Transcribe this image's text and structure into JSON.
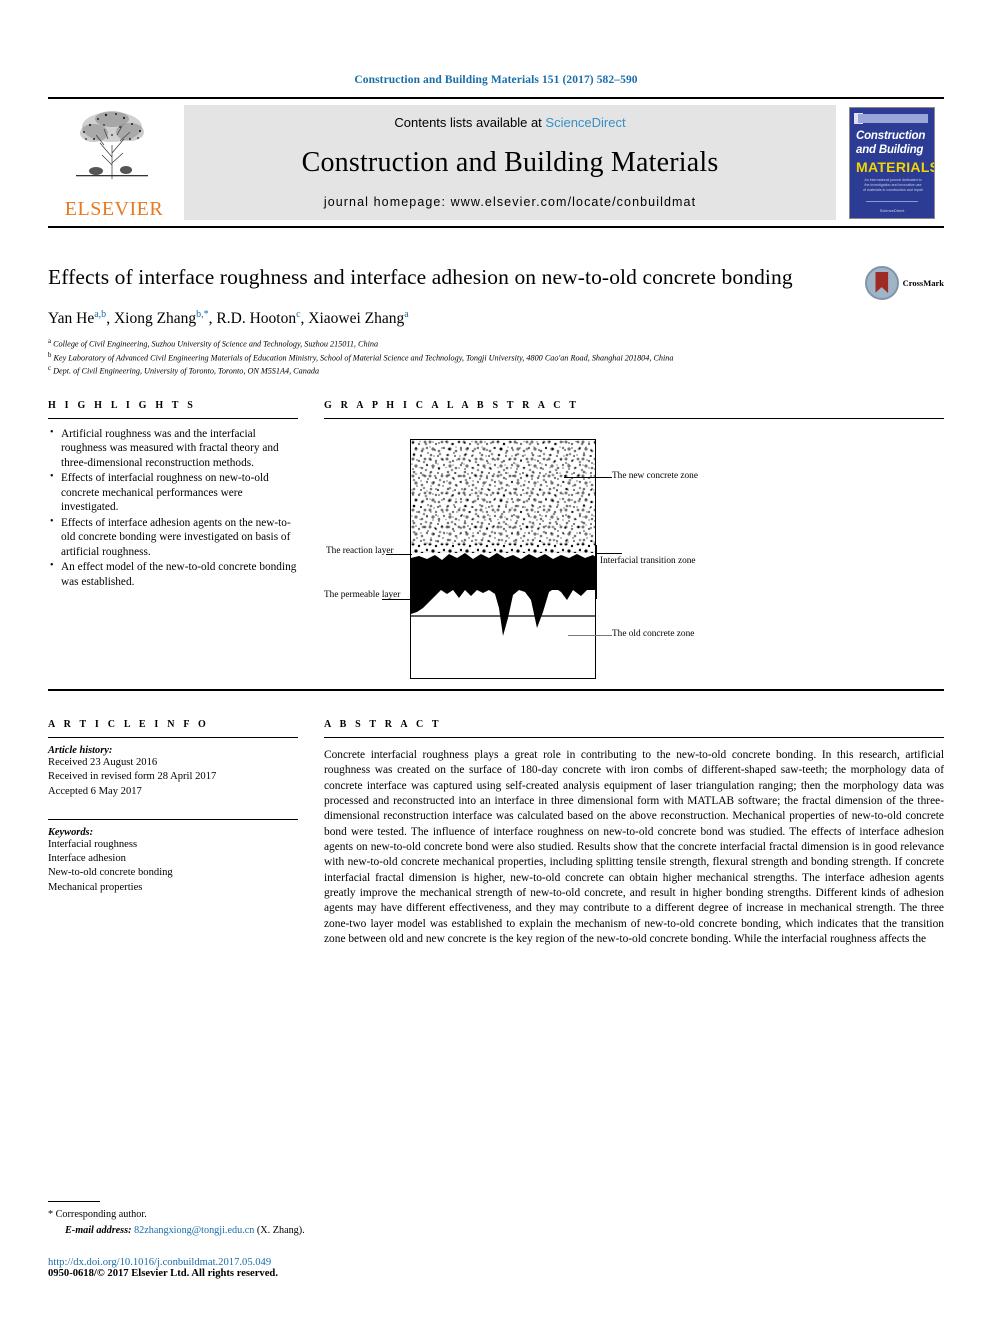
{
  "running_head": "Construction and Building Materials 151 (2017) 582–590",
  "masthead": {
    "contents_prefix": "Contents lists available at ",
    "sciencedirect": "ScienceDirect",
    "journal_title": "Construction and Building Materials",
    "homepage": "journal homepage: www.elsevier.com/locate/conbuildmat",
    "publisher": "ELSEVIER",
    "cover": {
      "line1": "Construction",
      "line2": "and Building",
      "line3": "MATERIALS",
      "blurb": "An international journal dedicated to the investigation and innovative use of materials in construction and repair",
      "foot": "ScienceDirect"
    },
    "accent_blue": "#3a8fc4",
    "elsevier_orange": "#e87722"
  },
  "article": {
    "title": "Effects of interface roughness and interface adhesion on new-to-old concrete bonding",
    "authors": [
      {
        "name": "Yan He",
        "sup": "a,b"
      },
      {
        "name": "Xiong Zhang",
        "sup": "b,*"
      },
      {
        "name": "R.D. Hooton",
        "sup": "c"
      },
      {
        "name": "Xiaowei Zhang",
        "sup": "a"
      }
    ],
    "affiliations": [
      {
        "marker": "a",
        "text": "College of Civil Engineering, Suzhou University of Science and Technology, Suzhou 215011, China"
      },
      {
        "marker": "b",
        "text": "Key Laboratory of Advanced Civil Engineering Materials of Education Ministry, School of Material Science and Technology, Tongji University, 4800 Cao'an Road, Shanghai 201804, China"
      },
      {
        "marker": "c",
        "text": "Dept. of Civil Engineering, University of Toronto, Toronto, ON M5S1A4, Canada"
      }
    ],
    "crossmark_label": "CrossMark"
  },
  "highlights": {
    "heading": "H I G H L I G H T S",
    "items": [
      "Artificial roughness was and the interfacial roughness was measured with fractal theory and three-dimensional reconstruction methods.",
      "Effects of interfacial roughness on new-to-old concrete mechanical performances were investigated.",
      "Effects of interface adhesion agents on the new-to-old concrete bonding were investigated on basis of artificial roughness.",
      "An effect model of the new-to-old concrete bonding was established."
    ]
  },
  "graphical_abstract": {
    "heading": "G R A P H I C A L   A B S T R A C T",
    "labels": {
      "new_concrete_zone": "The new concrete zone",
      "reaction_layer": "The reaction layer",
      "permeable_layer": "The permeable layer",
      "interfacial_transition_zone": "Interfacial transition zone",
      "old_concrete_zone": "The old concrete zone"
    }
  },
  "article_info": {
    "heading": "A R T I C L E   I N F O",
    "history_label": "Article history:",
    "history": [
      "Received 23 August 2016",
      "Received in revised form 28 April 2017",
      "Accepted 6 May 2017"
    ],
    "keywords_label": "Keywords:",
    "keywords": [
      "Interfacial roughness",
      "Interface adhesion",
      "New-to-old concrete bonding",
      "Mechanical properties"
    ]
  },
  "abstract": {
    "heading": "A B S T R A C T",
    "text": "Concrete interfacial roughness plays a great role in contributing to the new-to-old concrete bonding. In this research, artificial roughness was created on the surface of 180-day concrete with iron combs of different-shaped saw-teeth; the morphology data of concrete interface was captured using self-created analysis equipment of laser triangulation ranging; then the morphology data was processed and reconstructed into an interface in three dimensional form with MATLAB software; the fractal dimension of the three-dimensional reconstruction interface was calculated based on the above reconstruction. Mechanical properties of new-to-old concrete bond were tested. The influence of interface roughness on new-to-old concrete bond was studied. The effects of interface adhesion agents on new-to-old concrete bond were also studied. Results show that the concrete interfacial fractal dimension is in good relevance with new-to-old concrete mechanical properties, including splitting tensile strength, flexural strength and bonding strength. If concrete interfacial fractal dimension is higher, new-to-old concrete can obtain higher mechanical strengths. The interface adhesion agents greatly improve the mechanical strength of new-to-old concrete, and result in higher bonding strengths. Different kinds of adhesion agents may have different effectiveness, and they may contribute to a different degree of increase in mechanical strength. The three zone-two layer model was established to explain the mechanism of new-to-old concrete bonding, which indicates that the transition zone between old and new concrete is the key region of the new-to-old concrete bonding. While the interfacial roughness affects the"
  },
  "footer": {
    "corresponding_marker": "*",
    "corresponding_label": "Corresponding author.",
    "email_label": "E-mail address:",
    "email": "82zhangxiong@tongji.edu.cn",
    "email_suffix": "(X. Zhang).",
    "doi": "http://dx.doi.org/10.1016/j.conbuildmat.2017.05.049",
    "copyright": "0950-0618/© 2017 Elsevier Ltd. All rights reserved."
  }
}
